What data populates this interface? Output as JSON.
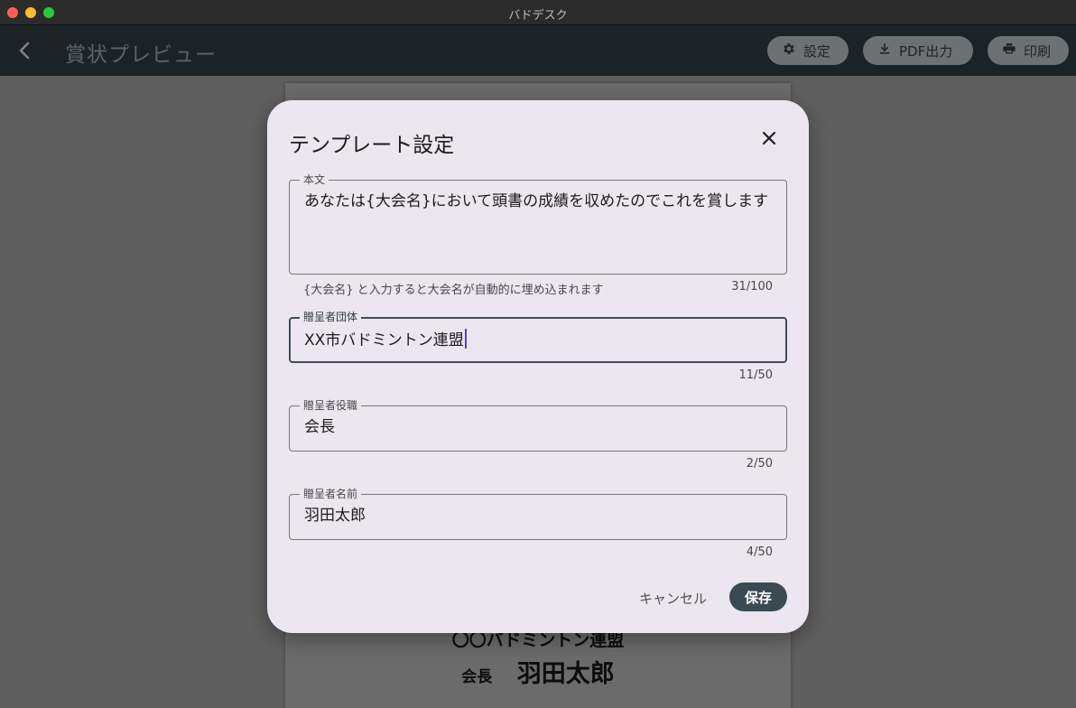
{
  "window": {
    "title": "バドデスク"
  },
  "appbar": {
    "title": "賞状プレビュー",
    "settings_label": "設定",
    "pdf_label": "PDF出力",
    "print_label": "印刷"
  },
  "certificate": {
    "org_partial": "〇〇バドミントン連盟",
    "position": "会長",
    "name": "羽田太郎"
  },
  "dialog": {
    "title": "テンプレート設定",
    "fields": {
      "body": {
        "label": "本文",
        "value": "あなたは{大会名}において頭書の成績を収めたのでこれを賞します",
        "helper": "{大会名} と入力すると大会名が自動的に埋め込まれます",
        "counter": "31/100"
      },
      "org": {
        "label": "贈呈者団体",
        "value": "XX市バドミントン連盟",
        "counter": "11/50"
      },
      "position": {
        "label": "贈呈者役職",
        "value": "会長",
        "counter": "2/50"
      },
      "name": {
        "label": "贈呈者名前",
        "value": "羽田太郎",
        "counter": "4/50"
      }
    },
    "cancel_label": "キャンセル",
    "save_label": "保存"
  },
  "icons": {
    "back": "chevron-left-icon",
    "settings": "gear-icon",
    "pdf": "download-icon",
    "print": "printer-icon",
    "close": "close-icon"
  },
  "colors": {
    "appbar_bg": "#1b2327",
    "dialog_bg": "#ece6f0",
    "primary_button": "#3a4a53"
  }
}
